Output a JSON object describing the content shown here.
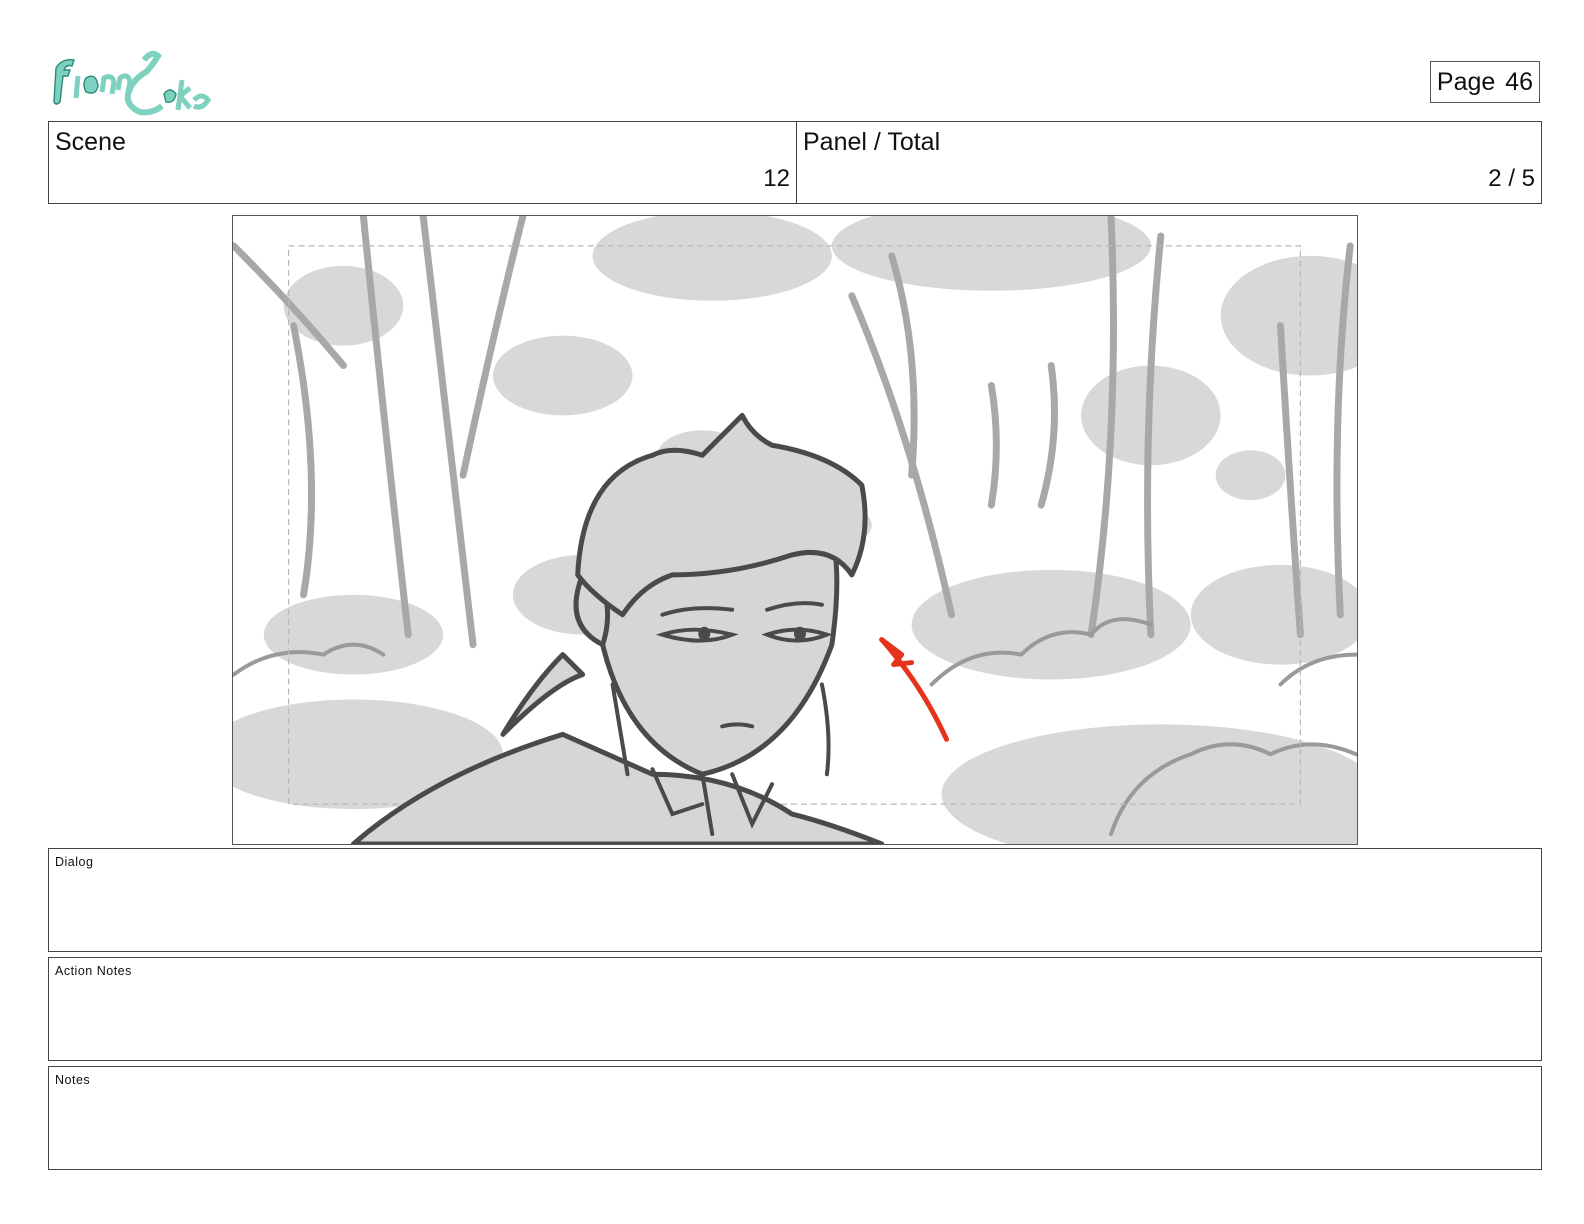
{
  "logo": {
    "icon": "fionna-and-cake-logo",
    "text": "Fionna and Cake",
    "color": "#6cc3b0"
  },
  "page": {
    "label": "Page",
    "number": "46"
  },
  "scene": {
    "label": "Scene",
    "value": "12"
  },
  "panel": {
    "label": "Panel / Total",
    "value": "2 / 5"
  },
  "panel_image": {
    "icon": "storyboard-sketch-forest-character",
    "line_color": "#4a4a4a",
    "fill_color": "#d6d6d6",
    "arrow_color": "#e8331c"
  },
  "notes": {
    "dialog_label": "Dialog",
    "action_label": "Action Notes",
    "notes_label": "Notes"
  }
}
